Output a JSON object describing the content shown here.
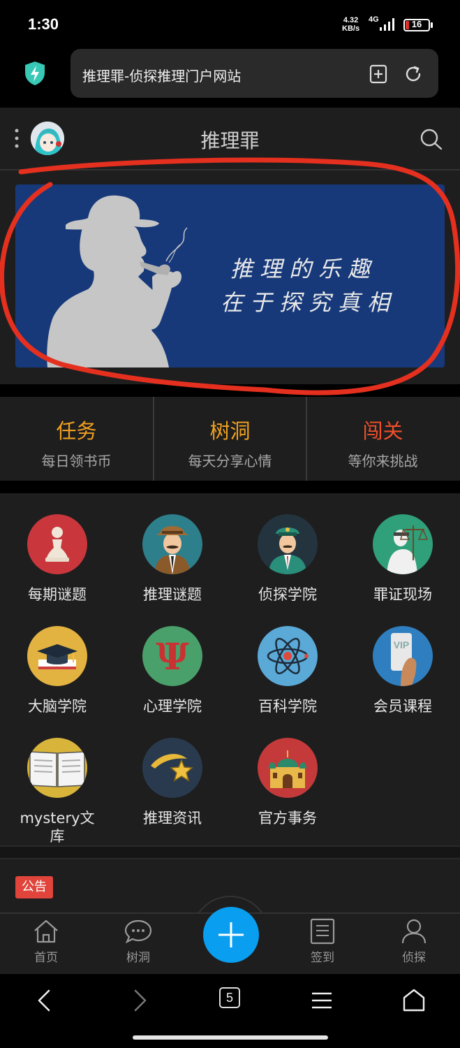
{
  "status_bar": {
    "time": "1:30",
    "net_speed_value": "4.32",
    "net_speed_unit": "KB/s",
    "network": "4G",
    "battery": "16"
  },
  "browser": {
    "url_title": "推理罪-侦探推理门户网站",
    "tab_count": "5"
  },
  "header": {
    "title": "推理罪"
  },
  "banner": {
    "line1": "推理的乐趣",
    "line2": "在于探究真相"
  },
  "quick_tiles": [
    {
      "title": "任务",
      "subtitle": "每日领书币",
      "color": "#f0a020"
    },
    {
      "title": "树洞",
      "subtitle": "每天分享心情",
      "color": "#f0a020"
    },
    {
      "title": "闯关",
      "subtitle": "等你来挑战",
      "color": "#f0502a"
    }
  ],
  "grid": [
    {
      "label": "每期谜题",
      "icon": "chess-pawn-icon",
      "bg": "#c9373d"
    },
    {
      "label": "推理谜题",
      "icon": "detective-icon",
      "bg": "#2e7f8c"
    },
    {
      "label": "侦探学院",
      "icon": "officer-icon",
      "bg": "#24343f"
    },
    {
      "label": "罪证现场",
      "icon": "justice-scales-icon",
      "bg": "#2fa07a"
    },
    {
      "label": "大脑学院",
      "icon": "graduation-cap-icon",
      "bg": "#e3b341"
    },
    {
      "label": "心理学院",
      "icon": "psi-icon",
      "bg": "#4aa06a"
    },
    {
      "label": "百科学院",
      "icon": "atom-icon",
      "bg": "#5aa9d6"
    },
    {
      "label": "会员课程",
      "icon": "vip-card-icon",
      "bg": "#2f7fc0"
    },
    {
      "label": "mystery文库",
      "icon": "open-book-icon",
      "bg": "#d9b43a"
    },
    {
      "label": "推理资讯",
      "icon": "shooting-star-icon",
      "bg": "#2a3a4e"
    },
    {
      "label": "官方事务",
      "icon": "palace-icon",
      "bg": "#c43a3a"
    }
  ],
  "notice": {
    "tag": "公告"
  },
  "tabbar": {
    "home": "首页",
    "treehole": "树洞",
    "checkin": "签到",
    "detective": "侦探"
  }
}
